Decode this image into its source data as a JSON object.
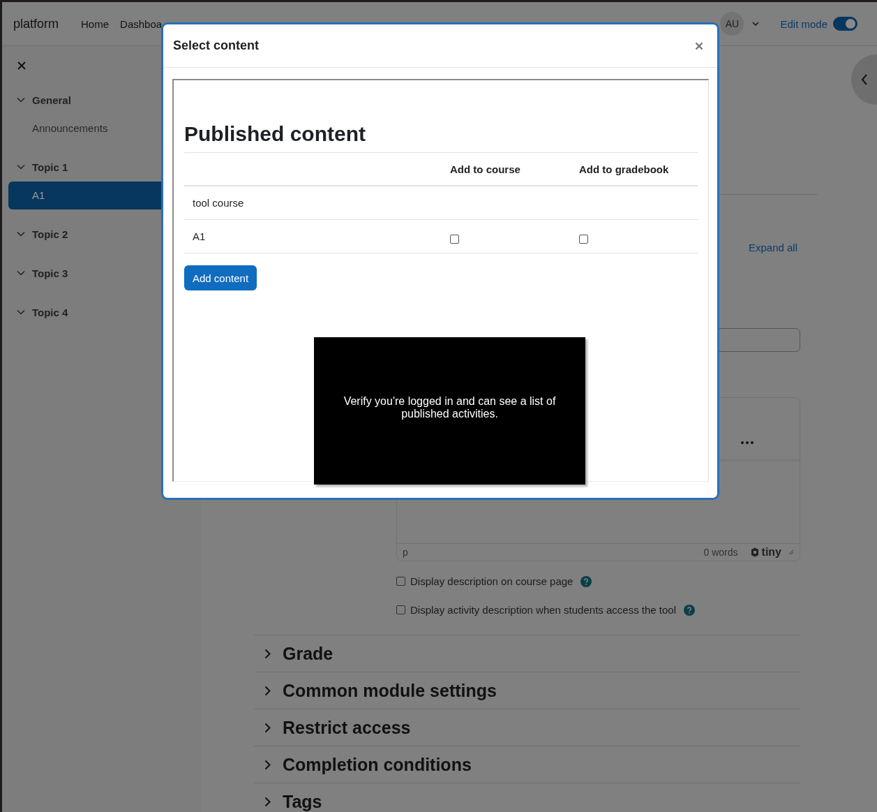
{
  "navbar": {
    "brand": "platform",
    "links": [
      "Home",
      "Dashboa"
    ],
    "avatar": "AU",
    "edit_mode": {
      "label": "Edit mode",
      "on": true
    }
  },
  "course_index": [
    {
      "title": "General",
      "expanded": true,
      "children": [
        {
          "label": "Announcements",
          "selected": false
        }
      ]
    },
    {
      "title": "Topic 1",
      "expanded": true,
      "children": [
        {
          "label": "A1",
          "selected": true
        }
      ]
    },
    {
      "title": "Topic 2",
      "expanded": true
    },
    {
      "title": "Topic 3",
      "expanded": true
    },
    {
      "title": "Topic 4",
      "expanded": true
    }
  ],
  "main": {
    "expand_all": "Expand all",
    "editor": {
      "path": "p",
      "word_count": "0 words",
      "logo": "tiny"
    },
    "options": [
      {
        "label": "Display description on course page",
        "checked": false
      },
      {
        "label": "Display activity description when students access the tool",
        "checked": false
      }
    ],
    "sections": [
      {
        "title": "Grade",
        "expanded": false
      },
      {
        "title": "Common module settings",
        "expanded": false
      },
      {
        "title": "Restrict access",
        "expanded": false
      },
      {
        "title": "Completion conditions",
        "expanded": false
      },
      {
        "title": "Tags",
        "expanded": false
      }
    ]
  },
  "modal": {
    "title": "Select content",
    "heading": "Published content",
    "columns": [
      "Add to course",
      "Add to gradebook"
    ],
    "rows": [
      {
        "kind": "group",
        "name": "tool course"
      },
      {
        "kind": "item",
        "name": "A1",
        "add_to_course": false,
        "add_to_gradebook": false
      }
    ],
    "button": "Add content",
    "tooltip": "Verify you're logged in and can see a list of published activities."
  }
}
